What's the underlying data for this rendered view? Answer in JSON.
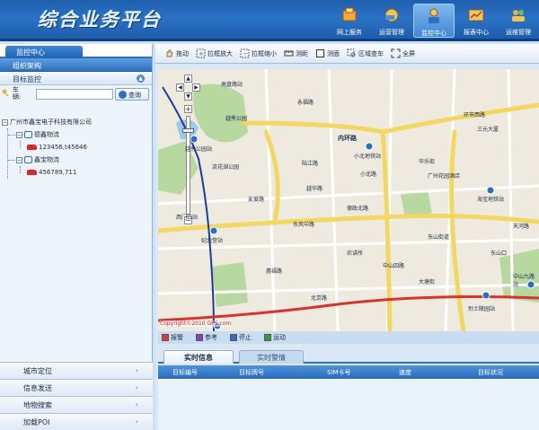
{
  "header": {
    "title": "综合业务平台",
    "nav": [
      {
        "label": "网上服务",
        "active": false
      },
      {
        "label": "运营管理",
        "active": false
      },
      {
        "label": "监控中心",
        "active": true
      },
      {
        "label": "报表中心",
        "active": false
      },
      {
        "label": "运维管理",
        "active": false
      }
    ]
  },
  "left": {
    "tab": "监控中心",
    "section_org": "组织架构",
    "section_target": "目标监控",
    "search": {
      "label": "车辆:",
      "value": "",
      "button": "查询"
    },
    "tree": {
      "company": "广州市鑫宝电子科技有限公司",
      "groups": [
        {
          "name": "德鑫物流",
          "vehicle": "123456,t45646"
        },
        {
          "name": "鑫宝物流",
          "vehicle": "456789,711"
        }
      ]
    },
    "menu": [
      "城市定位",
      "信息发送",
      "地物搜索",
      "加载POI"
    ]
  },
  "toolbar": {
    "tools": [
      "拖动",
      "拉框放大",
      "拉框缩小",
      "测距",
      "测面",
      "区域查车",
      "全屏"
    ]
  },
  "map": {
    "labels": {
      "dongfeng_road": "东风中路",
      "huanshi_road": "环市西路",
      "inner_ring": "内环路",
      "xiaobei": "小北地铁站",
      "yuexiu_park": "越秀公园站",
      "haiyin": "海宝地铁站",
      "jinianlu": "纪念堂站",
      "lieshi": "烈士陵园站",
      "zhongshan": "中山九路站",
      "gaopan": "高盘路站",
      "liu_hua": "流花湖公园",
      "yuexiu": "越秀公园",
      "ximen": "西门口站",
      "nongjiang": "农讲所",
      "beijing": "北京路",
      "dongshan": "东山口",
      "sanjin": "三元大厦",
      "guangzhou": "广州花园酒店",
      "huale": "华乐街",
      "dongshan_st": "东山街道",
      "dayang": "大塘街",
      "yuehua": "越华路",
      "dezheng": "德政北路",
      "xiaobei_rd": "小北路",
      "zhongshan_si": "中山四路",
      "tianhe": "天河路",
      "yongfu": "永福路",
      "huifu": "惠福路",
      "youai": "友爱路",
      "lujiang": "陆江路"
    },
    "copyright": "Copyright©2010 GPS.com"
  },
  "legend": [
    {
      "label": "报警",
      "color": "#e23a3a"
    },
    {
      "label": "参考",
      "color": "#8a3fb8"
    },
    {
      "label": "停止",
      "color": "#3a66c8"
    },
    {
      "label": "运动",
      "color": "#2e9e3a"
    }
  ],
  "info": {
    "tabs": [
      "实时信息",
      "实时警情"
    ],
    "columns": [
      "目标编号",
      "目标牌号",
      "SIM卡号",
      "速度",
      "目标状况"
    ]
  }
}
